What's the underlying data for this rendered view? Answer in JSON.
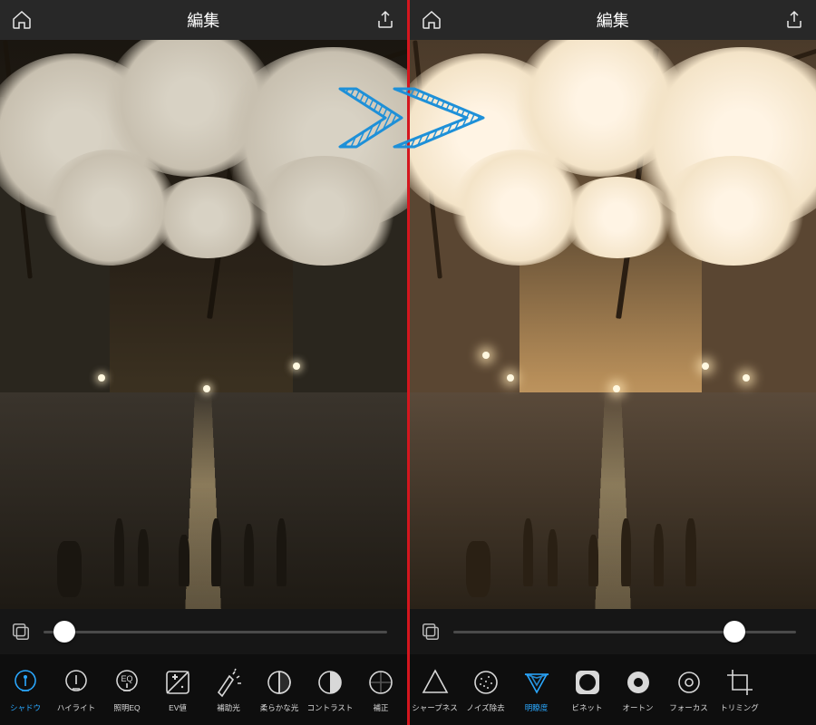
{
  "left": {
    "header": {
      "title": "編集"
    },
    "slider": {
      "position_pct": 6
    },
    "tools": [
      {
        "id": "shadow",
        "label": "シャドウ",
        "selected": true
      },
      {
        "id": "highlight",
        "label": "ハイライト",
        "selected": false
      },
      {
        "id": "lighteq",
        "label": "照明EQ",
        "selected": false
      },
      {
        "id": "ev",
        "label": "EV値",
        "selected": false
      },
      {
        "id": "fill",
        "label": "補助光",
        "selected": false
      },
      {
        "id": "soft",
        "label": "柔らかな光",
        "selected": false
      },
      {
        "id": "contrast",
        "label": "コントラスト",
        "selected": false
      },
      {
        "id": "correct",
        "label": "補正",
        "selected": false
      }
    ]
  },
  "right": {
    "header": {
      "title": "編集"
    },
    "slider": {
      "position_pct": 82
    },
    "tools": [
      {
        "id": "sharpness",
        "label": "シャープネス",
        "selected": false
      },
      {
        "id": "denoise",
        "label": "ノイズ除去",
        "selected": false
      },
      {
        "id": "clarity",
        "label": "明瞭度",
        "selected": true
      },
      {
        "id": "vignette",
        "label": "ビネット",
        "selected": false
      },
      {
        "id": "orton",
        "label": "オートン",
        "selected": false
      },
      {
        "id": "focus",
        "label": "フォーカス",
        "selected": false
      },
      {
        "id": "trim",
        "label": "トリミング",
        "selected": false
      }
    ]
  },
  "colors": {
    "accent": "#2aa8ff",
    "divider": "#d4161e",
    "annotation": "#1e90d8"
  },
  "icons": {
    "home": "home-icon",
    "share": "share-icon",
    "compare": "compare-icon"
  }
}
